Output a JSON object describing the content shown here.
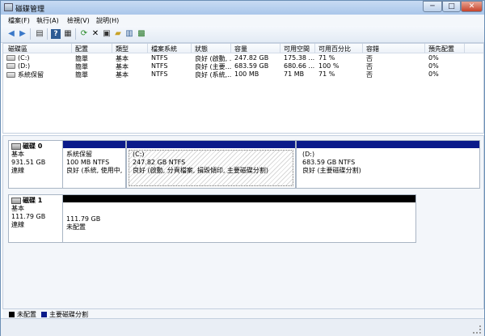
{
  "window": {
    "title": "磁碟管理",
    "min": "─",
    "max": "□",
    "close": "✕"
  },
  "menu": [
    {
      "label": "檔案(F)"
    },
    {
      "label": "執行(A)"
    },
    {
      "label": "檢視(V)"
    },
    {
      "label": "說明(H)"
    }
  ],
  "toolbar_icons": [
    "back-arrow-icon",
    "forward-arrow-icon",
    "console-tree-icon",
    "help-icon",
    "help-topics-icon",
    "refresh-icon",
    "delete-icon",
    "properties-icon",
    "open-folder-icon",
    "export-list-icon",
    "disk-settings-icon"
  ],
  "volume_list": {
    "columns": [
      "磁碟區",
      "配置",
      "類型",
      "檔案系統",
      "狀態",
      "容量",
      "可用空間",
      "可用百分比",
      "容錯",
      "預先配置"
    ],
    "rows": [
      [
        "(C:)",
        "簡單",
        "基本",
        "NTFS",
        "良好 (啟動, ...",
        "247.82 GB",
        "175.38 ...",
        "71 %",
        "否",
        "0%"
      ],
      [
        "(D:)",
        "簡單",
        "基本",
        "NTFS",
        "良好 (主要...",
        "683.59 GB",
        "680.66 ...",
        "100 %",
        "否",
        "0%"
      ],
      [
        "系統保留",
        "簡單",
        "基本",
        "NTFS",
        "良好 (系統,...",
        "100 MB",
        "71 MB",
        "71 %",
        "否",
        "0%"
      ]
    ]
  },
  "disks": [
    {
      "name": "磁碟 0",
      "type": "基本",
      "size": "931.51 GB",
      "status": "連線",
      "partitions": [
        {
          "name": "系統保留",
          "size": "100 MB NTFS",
          "status": "良好 (系統, 使用中, 主",
          "bar": "#0a1a8a"
        },
        {
          "name": "(C:)",
          "size": "247.82 GB NTFS",
          "status": "良好 (啟動, 分頁檔案, 損毀傾印, 主要磁碟分割)",
          "bar": "#0a1a8a"
        },
        {
          "name": "(D:)",
          "size": "683.59 GB NTFS",
          "status": "良好 (主要磁碟分割)",
          "bar": "#0a1a8a"
        }
      ]
    },
    {
      "name": "磁碟 1",
      "type": "基本",
      "size": "111.79 GB",
      "status": "連線",
      "partitions": [
        {
          "name": "",
          "size": "111.79 GB",
          "status": "未配置",
          "bar": "#000000"
        }
      ]
    }
  ],
  "legend": [
    {
      "label": "未配置",
      "color": "#000000"
    },
    {
      "label": "主要磁碟分割",
      "color": "#0a1a8a"
    }
  ]
}
